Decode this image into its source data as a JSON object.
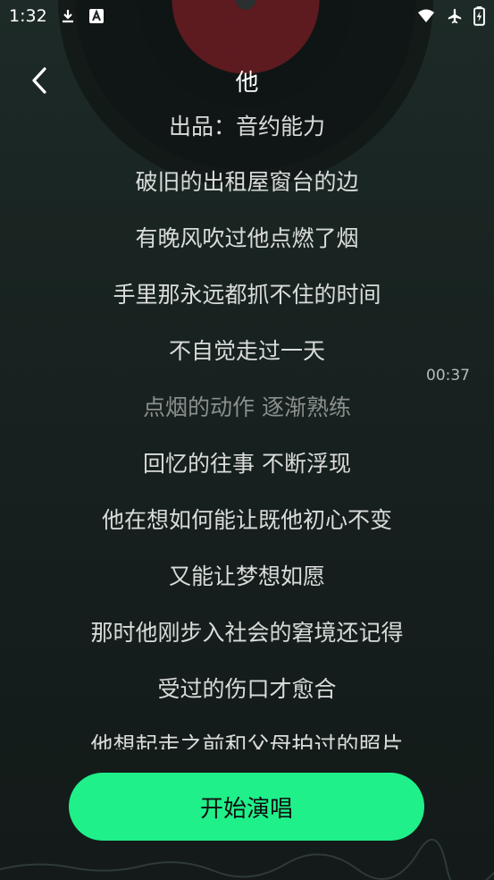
{
  "status_bar": {
    "time": "1:32",
    "icons": [
      "download-icon",
      "font-icon",
      "wifi-icon",
      "airplane-icon",
      "battery-icon"
    ]
  },
  "header": {
    "title": "他",
    "back_icon": "chevron-left-icon"
  },
  "lyrics": {
    "lines": [
      "出品：音约能力",
      "破旧的出租屋窗台的边",
      "有晚风吹过他点燃了烟",
      "手里那永远都抓不住的时间",
      "不自觉走过一天",
      "点烟的动作 逐渐熟练",
      "回忆的往事 不断浮现",
      "他在想如何能让既他初心不变",
      "又能让梦想如愿",
      "那时他刚步入社会的窘境还记得",
      "受过的伤口才愈合",
      "他想起走之前和父母拍过的照片"
    ],
    "current_time": "00:37"
  },
  "action": {
    "start_label": "开始演唱"
  },
  "colors": {
    "accent": "#1ff08a",
    "background": "#1a2623"
  }
}
